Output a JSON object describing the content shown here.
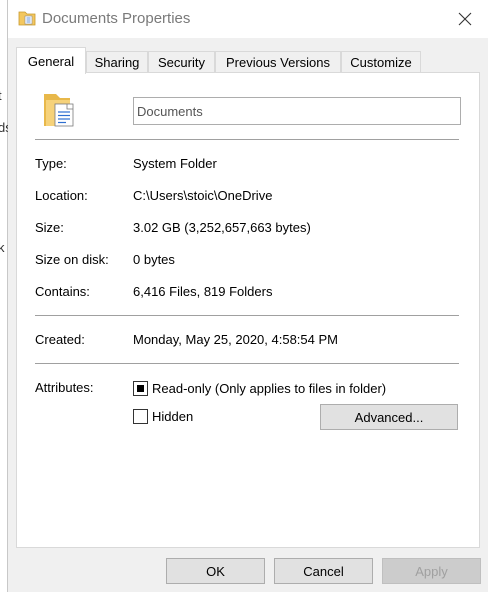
{
  "window": {
    "title": "Documents Properties"
  },
  "tabs": [
    {
      "label": "General",
      "active": true
    },
    {
      "label": "Sharing"
    },
    {
      "label": "Security"
    },
    {
      "label": "Previous Versions"
    },
    {
      "label": "Customize"
    }
  ],
  "general": {
    "name_value": "Documents",
    "rows": {
      "type": {
        "label": "Type:",
        "value": "System Folder"
      },
      "location": {
        "label": "Location:",
        "value": "C:\\Users\\stoic\\OneDrive"
      },
      "size": {
        "label": "Size:",
        "value": "3.02 GB (3,252,657,663 bytes)"
      },
      "size_on_disk": {
        "label": "Size on disk:",
        "value": "0 bytes"
      },
      "contains": {
        "label": "Contains:",
        "value": "6,416 Files, 819 Folders"
      },
      "created": {
        "label": "Created:",
        "value": "Monday, May 25, 2020, 4:58:54 PM"
      }
    },
    "attributes": {
      "label": "Attributes:",
      "readonly": {
        "label": "Read-only (Only applies to files in folder)",
        "state": "indeterminate"
      },
      "hidden": {
        "label": "Hidden",
        "checked": false
      },
      "advanced_label": "Advanced..."
    }
  },
  "footer": {
    "ok": "OK",
    "cancel": "Cancel",
    "apply": "Apply"
  },
  "behind": {
    "chars": [
      "t",
      "ds",
      "k"
    ]
  },
  "colors": {
    "accent_folder": "#e8b84a",
    "button_face": "#e1e1e1",
    "panel_border": "#d9d9d9"
  }
}
